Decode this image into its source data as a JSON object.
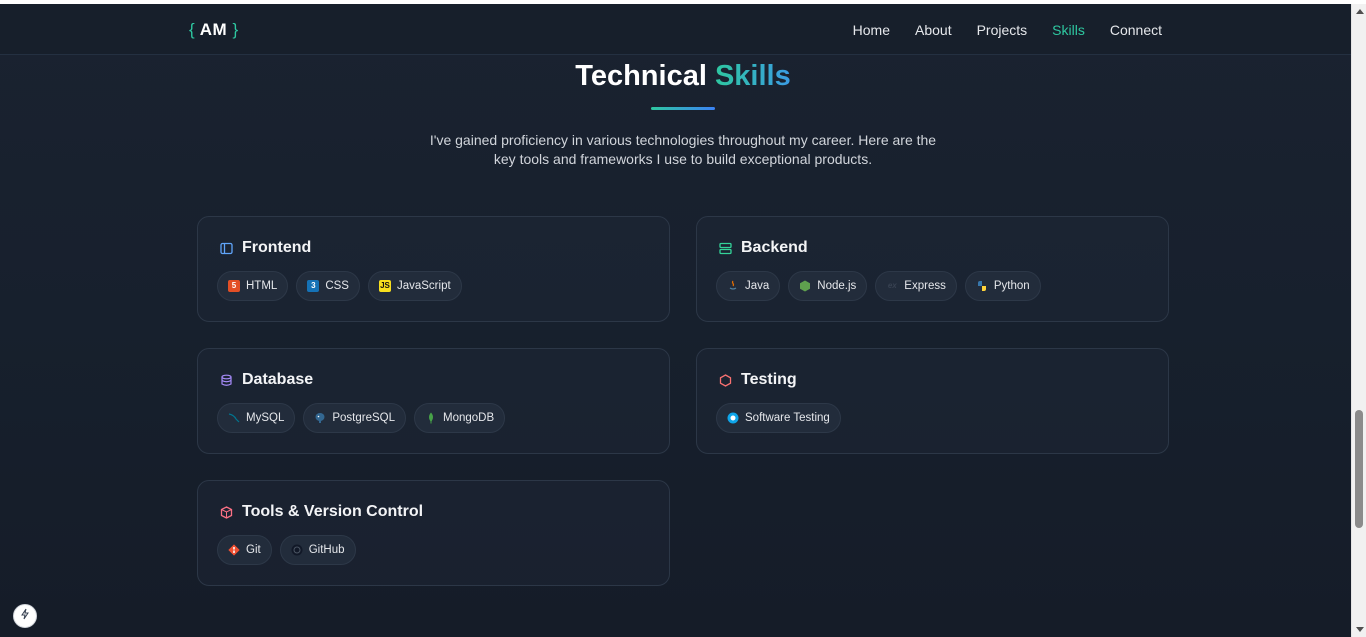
{
  "navbar": {
    "logo_open": "{",
    "logo_text": "AM",
    "logo_close": "}",
    "links": [
      "Home",
      "About",
      "Projects",
      "Skills",
      "Connect"
    ],
    "active": "Skills"
  },
  "hero": {
    "title_main": "Technical",
    "title_accent": "Skills",
    "description": "I've gained proficiency in various technologies throughout my career. Here are the key tools and frameworks I use to build exceptional products."
  },
  "categories": [
    {
      "title": "Frontend",
      "icon": "layout-icon",
      "icon_color": "#60a5fa",
      "skills": [
        {
          "name": "HTML",
          "icon": "html5-icon",
          "color": "#e34f26"
        },
        {
          "name": "CSS",
          "icon": "css3-icon",
          "color": "#1572b6"
        },
        {
          "name": "JavaScript",
          "icon": "javascript-icon",
          "color": "#f7df1e"
        }
      ]
    },
    {
      "title": "Backend",
      "icon": "server-icon",
      "icon_color": "#34d399",
      "skills": [
        {
          "name": "Java",
          "icon": "java-icon",
          "color": "#e76f00"
        },
        {
          "name": "Node.js",
          "icon": "nodejs-icon",
          "color": "#5fa04e"
        },
        {
          "name": "Express",
          "icon": "express-icon",
          "color": "#1f2937"
        },
        {
          "name": "Python",
          "icon": "python-icon",
          "color": "#3776ab"
        }
      ]
    },
    {
      "title": "Database",
      "icon": "database-icon",
      "icon_color": "#a78bfa",
      "skills": [
        {
          "name": "MySQL",
          "icon": "mysql-icon",
          "color": "#00758f"
        },
        {
          "name": "PostgreSQL",
          "icon": "postgresql-icon",
          "color": "#336791"
        },
        {
          "name": "MongoDB",
          "icon": "mongodb-icon",
          "color": "#47a248"
        }
      ]
    },
    {
      "title": "Testing",
      "icon": "hexagon-icon",
      "icon_color": "#f87171",
      "skills": [
        {
          "name": "Software Testing",
          "icon": "testing-icon",
          "color": "#0ea5e9"
        }
      ]
    },
    {
      "title": "Tools & Version Control",
      "icon": "box-icon",
      "icon_color": "#fb7185",
      "skills": [
        {
          "name": "Git",
          "icon": "git-icon",
          "color": "#f05032"
        },
        {
          "name": "GitHub",
          "icon": "github-icon",
          "color": "#111827"
        }
      ]
    }
  ],
  "colors": {
    "accent": "#2ec7a0",
    "accent_blue": "#3b9ce5",
    "background": "#18212e",
    "card_border": "#2c3747"
  }
}
